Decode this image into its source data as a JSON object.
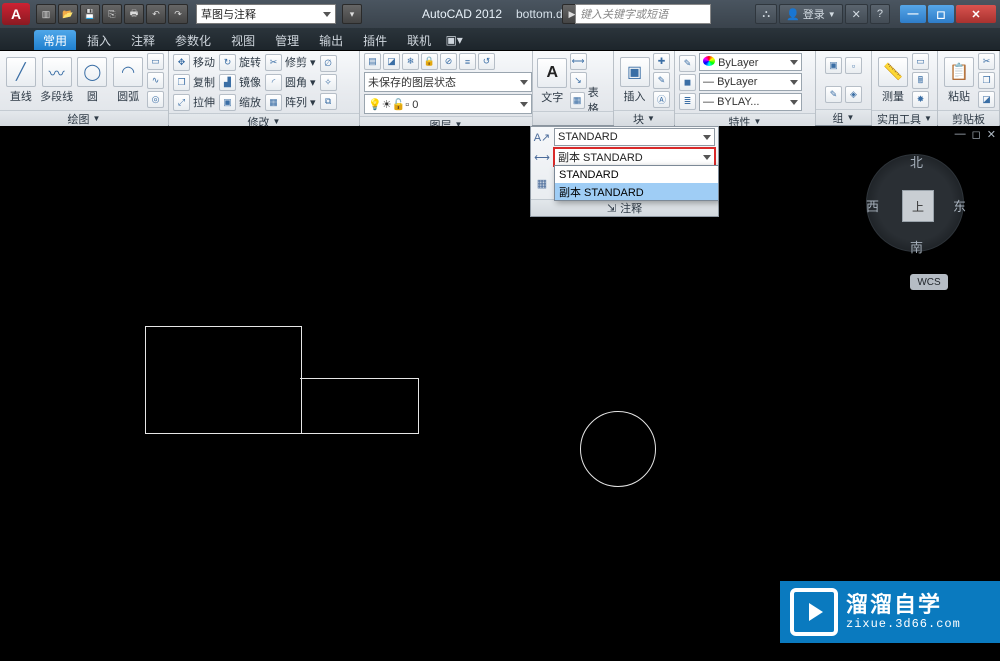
{
  "titlebar": {
    "app": "AutoCAD 2012",
    "file": "bottom.dwg",
    "workspace": "草图与注释",
    "search_ph": "键入关键字或短语",
    "login": "登录"
  },
  "tabs": [
    "常用",
    "插入",
    "注释",
    "参数化",
    "视图",
    "管理",
    "输出",
    "插件",
    "联机"
  ],
  "panels": {
    "draw": {
      "title": "绘图",
      "items": [
        "直线",
        "多段线",
        "圆",
        "圆弧"
      ]
    },
    "modify": {
      "title": "修改",
      "rows": [
        [
          "移动",
          "旋转",
          "修剪"
        ],
        [
          "复制",
          "镜像",
          "圆角"
        ],
        [
          "拉伸",
          "缩放",
          "阵列"
        ]
      ]
    },
    "layer": {
      "title": "图层",
      "state": "未保存的图层状态",
      "current": "0"
    },
    "annot": {
      "title": "注释",
      "text_btn": "文字",
      "table_btn": "表格"
    },
    "block": {
      "title": "块",
      "btn": "插入"
    },
    "props": {
      "title": "特性",
      "rows": [
        "ByLayer",
        "ByLayer",
        "BYLAY..."
      ]
    },
    "group": {
      "title": "组"
    },
    "util": {
      "title": "实用工具",
      "btn": "测量"
    },
    "clip": {
      "title": "剪贴板",
      "btn": "粘贴"
    }
  },
  "anno_panel": {
    "row1": "STANDARD",
    "row2": "副本 STANDARD",
    "title": "注释",
    "options": [
      "STANDARD",
      "副本 STANDARD"
    ]
  },
  "viewcube": {
    "top": "上",
    "n": "北",
    "s": "南",
    "e": "东",
    "w": "西",
    "wcs": "WCS"
  },
  "watermark": {
    "big": "溜溜自学",
    "small": "zixue.3d66.com"
  }
}
